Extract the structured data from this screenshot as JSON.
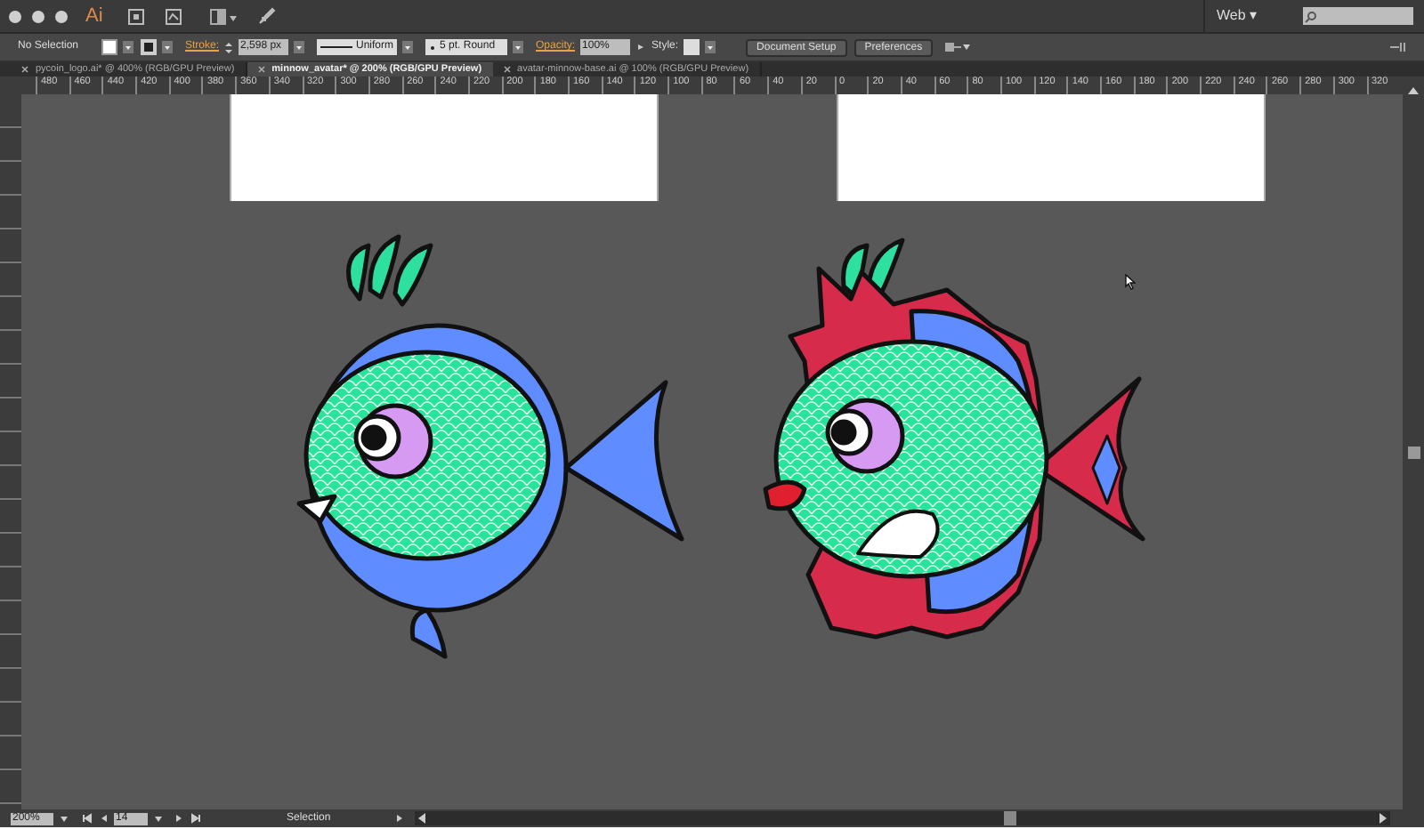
{
  "app_bar": {
    "logo": "Ai",
    "workspace": "Web",
    "workspace_caret": "▾"
  },
  "control_bar": {
    "selection": "No Selection",
    "stroke_label": "Stroke:",
    "stroke_weight": "2,598 px",
    "profile": "Uniform",
    "brush": "5 pt. Round",
    "opacity_label": "Opacity:",
    "opacity": "100%",
    "style_label": "Style:",
    "buttons": [
      "Document Setup",
      "Preferences"
    ]
  },
  "tabs": [
    {
      "label": "pycoin_logo.ai* @ 400% (RGB/GPU Preview)",
      "selected": false
    },
    {
      "label": "minnow_avatar* @ 200% (RGB/GPU Preview)",
      "selected": true
    },
    {
      "label": "avatar-minnow-base.ai @ 100% (RGB/GPU Preview)",
      "selected": false
    }
  ],
  "ruler": {
    "labels": [
      "480",
      "460",
      "440",
      "420",
      "400",
      "380",
      "360",
      "340",
      "320",
      "300",
      "280",
      "260",
      "240",
      "220",
      "200",
      "180",
      "160",
      "140",
      "120",
      "100",
      "80",
      "60",
      "40",
      "20",
      "0",
      "20",
      "40",
      "60",
      "80",
      "100",
      "120",
      "140",
      "160",
      "180",
      "200",
      "220",
      "240",
      "260",
      "280",
      "300",
      "320"
    ]
  },
  "status_bar": {
    "zoom": "200%",
    "artboard": "14",
    "tool": "Selection"
  }
}
